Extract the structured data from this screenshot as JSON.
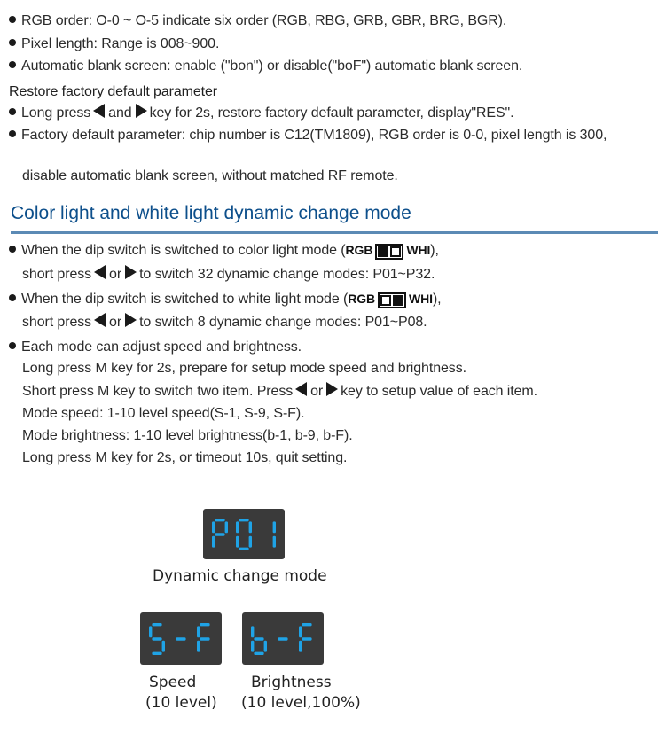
{
  "settings_bullets": [
    "RGB order: O-0 ~ O-5 indicate six order (RGB, RBG, GRB, GBR, BRG, BGR).",
    "Pixel length: Range is 008~900.",
    "Automatic blank screen: enable (\"bon\") or disable(\"boF\") automatic blank screen."
  ],
  "restore": {
    "heading": "Restore factory default parameter",
    "long_press": {
      "pre": "Long press",
      "mid": "and",
      "post": "key for 2s, restore factory default parameter, display\"RES\"."
    },
    "defaults_line1": "Factory default parameter: chip number is C12(TM1809), RGB order is 0-0, pixel length is 300,",
    "defaults_line2": "disable automatic blank screen, without matched RF remote."
  },
  "section": {
    "title": "Color light and white light dynamic change mode",
    "accent_color": "#0d4f8b",
    "rule_color": "#5b8ab5"
  },
  "dip_label_left": "RGB",
  "dip_label_right": "WHI",
  "color_mode": {
    "line1_pre": "When the dip switch is switched to color light mode (",
    "line1_post": "),",
    "dip_state": [
      "on",
      "off"
    ],
    "line2_pre": "short press",
    "line2_mid": "or",
    "line2_post": "to switch 32 dynamic change modes: P01~P32."
  },
  "white_mode": {
    "line1_pre": "When the dip switch is switched to white light mode (",
    "line1_post": "),",
    "dip_state": [
      "off",
      "on"
    ],
    "line2_pre": "short press",
    "line2_mid": "or",
    "line2_post": "to switch 8 dynamic change modes: P01~P08."
  },
  "adjust": {
    "bullet": "Each mode can adjust speed and brightness.",
    "lines": [
      "Long press M key for 2s, prepare for setup mode speed and brightness.",
      "Mode speed: 1-10 level speed(S-1, S-9, S-F).",
      "Mode brightness: 1-10 level brightness(b-1, b-9, b-F).",
      "Long press M key for 2s, or timeout 10s, quit setting."
    ],
    "short_press": {
      "pre": "Short press M key to switch two item. Press",
      "mid": "or",
      "post": "key to setup value of each item."
    }
  },
  "displays": {
    "digit_color": "#1fa3e6",
    "panel_color": "#3a3a3a",
    "mode": {
      "chars": [
        "P",
        "0",
        "1"
      ],
      "caption": "Dynamic change mode"
    },
    "speed": {
      "chars": [
        "S",
        "-",
        "F"
      ],
      "caption_line1": "Speed",
      "caption_line2": "(10 level)"
    },
    "brightness": {
      "chars": [
        "b",
        "-",
        "F"
      ],
      "caption_line1": "Brightness",
      "caption_line2": "(10 level,100%)"
    }
  }
}
